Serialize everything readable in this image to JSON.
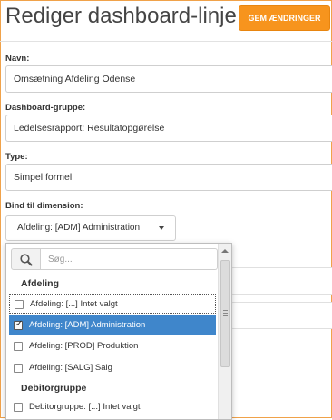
{
  "header": {
    "title": "Rediger dashboard-linje",
    "save_label": "GEM ÆNDRINGER"
  },
  "form": {
    "name_label": "Navn:",
    "name_value": "Omsætning Afdeling Odense",
    "group_label": "Dashboard-gruppe:",
    "group_value": "Ledelsesrapport: Resultatopgørelse",
    "type_label": "Type:",
    "type_value": "Simpel formel",
    "dimension_label": "Bind til dimension:",
    "dimension_value": "Afdeling: [ADM] Administration"
  },
  "dropdown": {
    "search_placeholder": "Søg...",
    "groups": [
      {
        "label": "Afdeling",
        "items": [
          {
            "label": "Afdeling: [...] Intet valgt",
            "checked": false
          },
          {
            "label": "Afdeling: [ADM] Administration",
            "checked": true
          },
          {
            "label": "Afdeling: [PROD] Produktion",
            "checked": false
          },
          {
            "label": "Afdeling: [SALG] Salg",
            "checked": false
          }
        ]
      },
      {
        "label": "Debitorgruppe",
        "items": [
          {
            "label": "Debitorgruppe: [...] Intet valgt",
            "checked": false
          }
        ]
      }
    ]
  },
  "colors": {
    "accent": "#f7941d",
    "selected_row": "#3f86cb"
  }
}
